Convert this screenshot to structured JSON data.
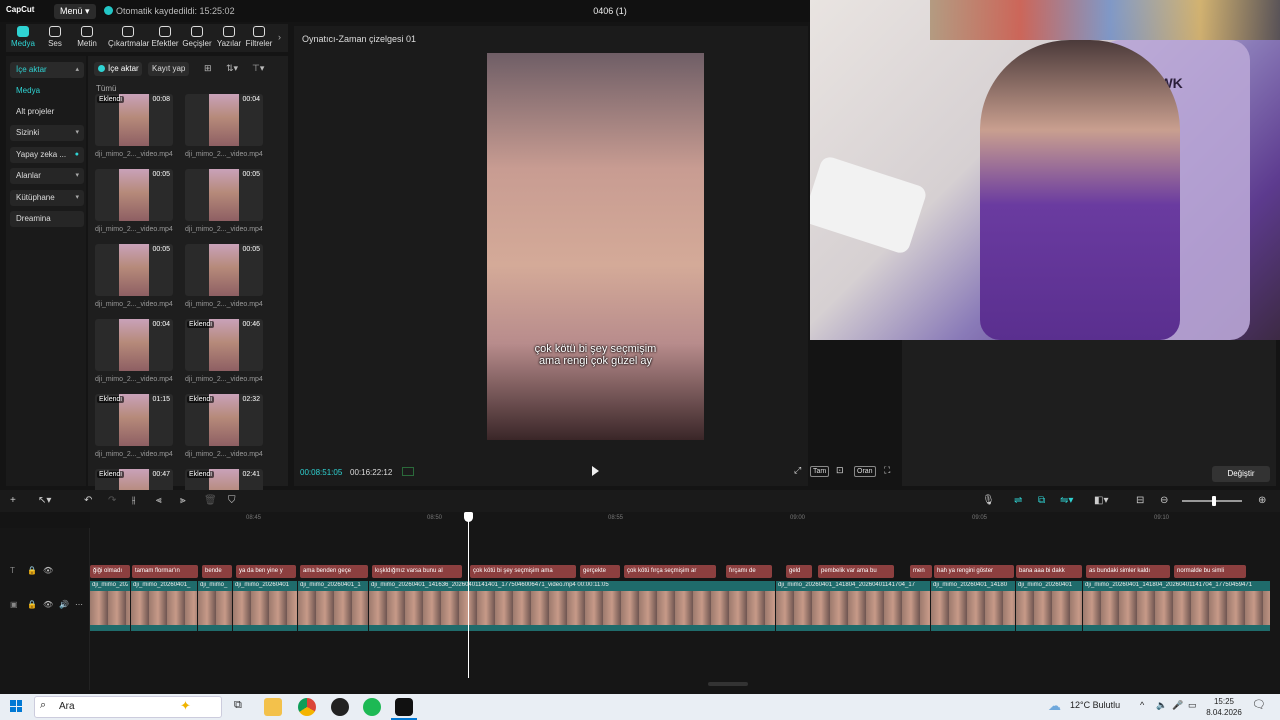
{
  "titlebar": {
    "logo": "CapCut",
    "menu_label": "Menü",
    "autosave": "Otomatik kaydedildi: 15:25:02",
    "project_title": "0406 (1)"
  },
  "tabs": [
    {
      "label": "Medya"
    },
    {
      "label": "Ses"
    },
    {
      "label": "Metin"
    },
    {
      "label": "Çıkartmalar"
    },
    {
      "label": "Efektler"
    },
    {
      "label": "Geçişler"
    },
    {
      "label": "Yazılar"
    },
    {
      "label": "Filtreler"
    }
  ],
  "leftnav": {
    "items": [
      {
        "label": "İçe aktar"
      },
      {
        "label": "Medya"
      },
      {
        "label": "Alt projeler"
      },
      {
        "label": "Sizinki"
      },
      {
        "label": "Yapay zeka ..."
      },
      {
        "label": "Alanlar"
      },
      {
        "label": "Kütüphane"
      },
      {
        "label": "Dreamina"
      }
    ]
  },
  "media": {
    "import_label": "İçe aktar",
    "record_label": "Kayıt yap",
    "all_label": "Tümü",
    "added_label": "Eklendi",
    "clips": [
      {
        "duration": "00:08",
        "added": true,
        "name": "dji_mimo_2..._video.mp4"
      },
      {
        "duration": "00:04",
        "added": false,
        "name": "dji_mimo_2..._video.mp4"
      },
      {
        "duration": "00:05",
        "added": false,
        "name": "dji_mimo_2..._video.mp4"
      },
      {
        "duration": "00:05",
        "added": false,
        "name": "dji_mimo_2..._video.mp4"
      },
      {
        "duration": "00:05",
        "added": false,
        "name": "dji_mimo_2..._video.mp4"
      },
      {
        "duration": "00:05",
        "added": false,
        "name": "dji_mimo_2..._video.mp4"
      },
      {
        "duration": "00:04",
        "added": false,
        "name": "dji_mimo_2..._video.mp4"
      },
      {
        "duration": "00:46",
        "added": true,
        "name": "dji_mimo_2..._video.mp4"
      },
      {
        "duration": "01:15",
        "added": true,
        "name": "dji_mimo_2..._video.mp4"
      },
      {
        "duration": "02:32",
        "added": true,
        "name": "dji_mimo_2..._video.mp4"
      },
      {
        "duration": "00:47",
        "added": true,
        "name": ""
      },
      {
        "duration": "02:41",
        "added": true,
        "name": ""
      }
    ]
  },
  "player": {
    "title": "Oynatıcı-Zaman çizelgesi 01",
    "subtitle_line1": "çok kötü bi şey seçmişim",
    "subtitle_line2": "ama rengi çok güzel ay",
    "current_time": "00:08:51:05",
    "total_time": "00:16:22:12",
    "full_label": "Tam",
    "ratio_label": "Oran"
  },
  "webcam": {
    "chair_brand": "HAWK"
  },
  "rightpanel": {
    "change_label": "Değiştir"
  },
  "timeline": {
    "ruler": [
      "08:45",
      "08:50",
      "08:55",
      "09:00",
      "09:05",
      "09:10"
    ],
    "text_clips": [
      "ğiği olmadı",
      "tamam flormar'ın",
      "bende",
      "ya da ben yine y",
      "ama benden geçe",
      "kışkldığmız varsa bunu al",
      "çok kötü bi şey seçmişim ama",
      "gerçekte",
      "çok kötü fırça seçmişim ar",
      "fırçamı de",
      "geld",
      "pembelik var ama bu",
      "men",
      "hah ya rengini göster",
      "bana aaa bi dakk",
      "as bundaki simler kaldı",
      "normalde bu simli"
    ],
    "video_labels": [
      "dji_mimo_20260",
      "dji_mimo_20260401_",
      "dji_mimo_",
      "dji_mimo_20260401",
      "dji_mimo_20260401_1",
      "dji_mimo_20260401_141636_20260401141401_1775046006471_video.mp4   00:00:11:05",
      "dji_mimo_20260401_141804_20260401141704_17",
      "dji_mimo_20260401_14180",
      "dji_mimo_20260401",
      "dji_mimo_20260401_141804_20260401141704_17750459471"
    ]
  },
  "taskbar": {
    "search_placeholder": "Ara",
    "weather": "12°C  Bulutlu",
    "time": "15:25",
    "date": "8.04.2026"
  }
}
